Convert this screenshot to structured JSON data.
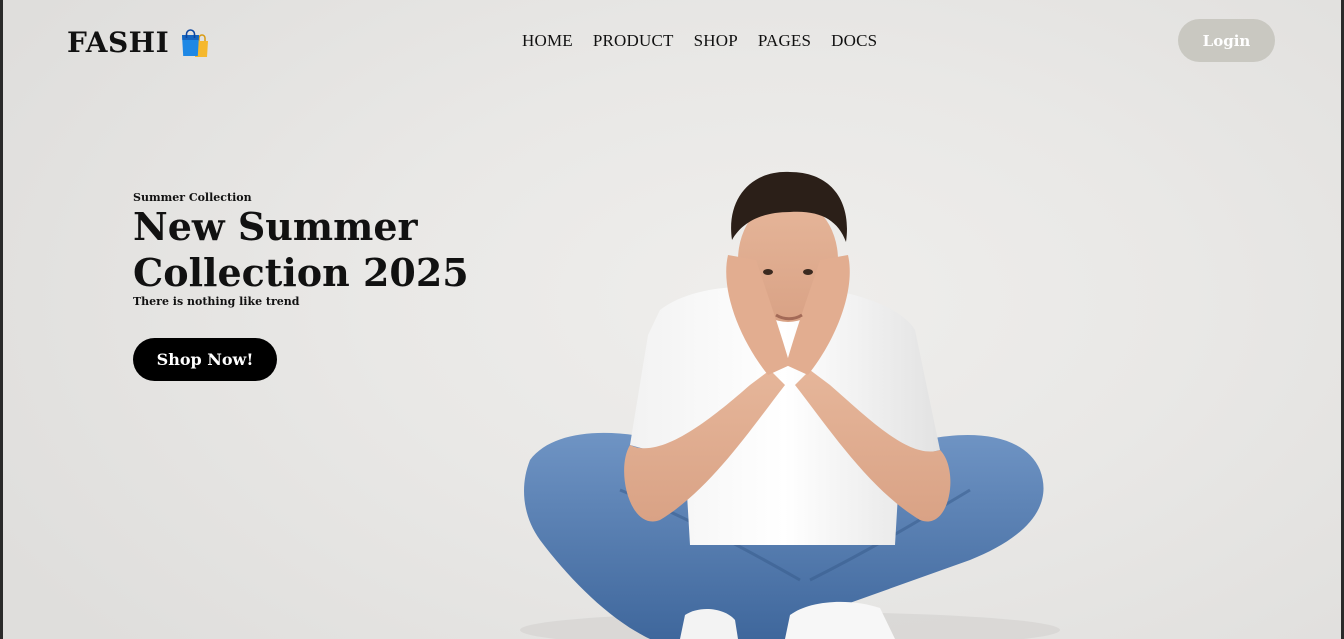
{
  "header": {
    "brand": "FASHI",
    "brand_icon": "shopping-bags-icon",
    "nav": [
      "HOME",
      "PRODUCT",
      "SHOP",
      "PAGES",
      "DOCS"
    ],
    "login_label": "Login"
  },
  "hero": {
    "eyebrow": "Summer Collection",
    "title": "New Summer Collection 2025",
    "subtitle": "There is nothing like trend",
    "cta_label": "Shop Now!",
    "image": "model-sitting-cross-legged"
  },
  "colors": {
    "background": "#e8e7e5",
    "login_button": "#c9c8c1",
    "cta_button": "#000000",
    "bag_blue": "#1e88e5",
    "bag_yellow": "#f5b82e"
  }
}
